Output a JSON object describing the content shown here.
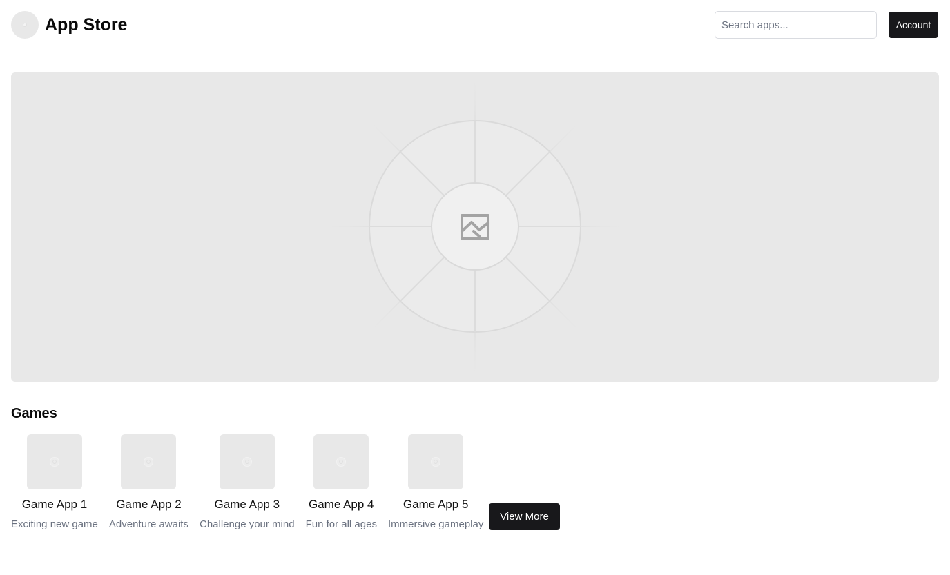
{
  "header": {
    "logo_icon": "logo-placeholder-icon",
    "title": "App Store",
    "search": {
      "placeholder": "Search apps...",
      "value": ""
    },
    "account_label": "Account"
  },
  "banner": {
    "icon": "image-placeholder-icon"
  },
  "games": {
    "title": "Games",
    "items": [
      {
        "name": "Game App 1",
        "description": "Exciting new game"
      },
      {
        "name": "Game App 2",
        "description": "Adventure awaits"
      },
      {
        "name": "Game App 3",
        "description": "Challenge your mind"
      },
      {
        "name": "Game App 4",
        "description": "Fun for all ages"
      },
      {
        "name": "Game App 5",
        "description": "Immersive gameplay"
      }
    ],
    "view_more_label": "View More"
  },
  "colors": {
    "primary_button": "#18181b",
    "placeholder_bg": "#e8e8e8",
    "muted_text": "#6b7280"
  }
}
